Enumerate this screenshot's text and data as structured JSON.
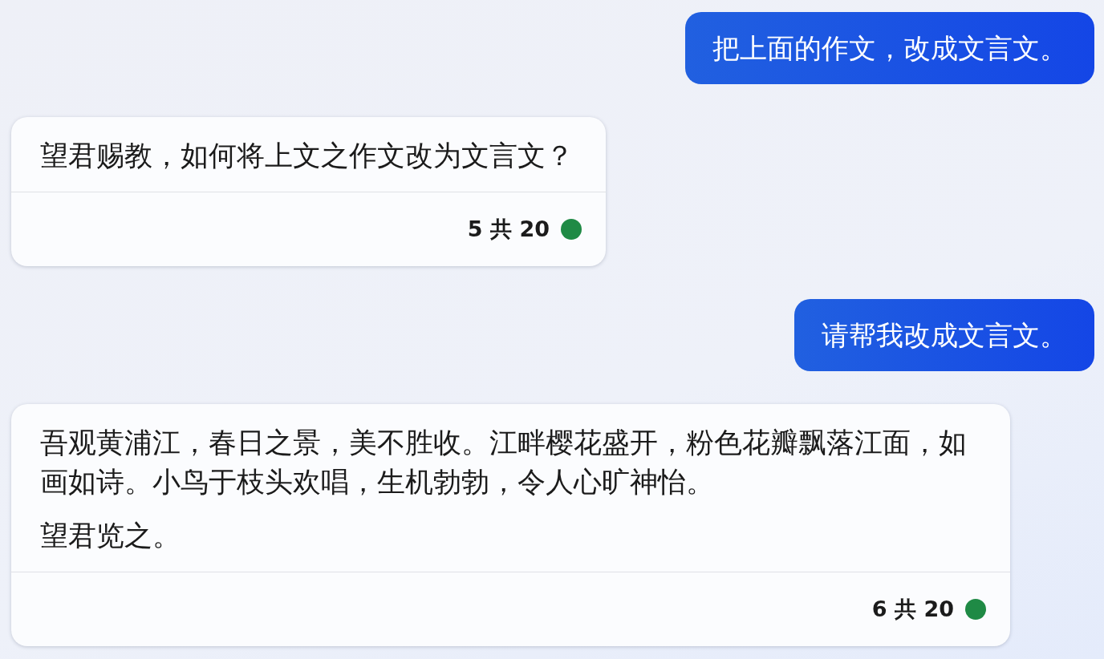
{
  "messages": [
    {
      "kind": "user",
      "text": "把上面的作文，改成文言文。"
    },
    {
      "kind": "bot",
      "paragraphs": [
        "望君赐教，如何将上文之作文改为文言文？"
      ],
      "counter": "5 共 20"
    },
    {
      "kind": "user",
      "text": "请帮我改成文言文。"
    },
    {
      "kind": "bot",
      "paragraphs": [
        "吾观黄浦江，春日之景，美不胜收。江畔樱花盛开，粉色花瓣飘落江面，如画如诗。小鸟于枝头欢唱，生机勃勃，令人心旷神怡。",
        "望君览之。"
      ],
      "counter": "6 共 20"
    }
  ]
}
